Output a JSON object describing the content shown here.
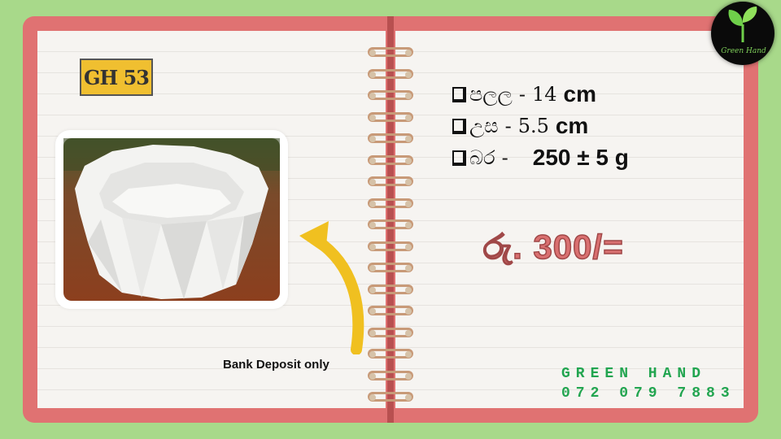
{
  "product": {
    "code": "GH 53",
    "image_icon": "white-planter-pot-photo",
    "arrow_icon": "curved-arrow-icon",
    "arrow_color": "#f0c020"
  },
  "specs": [
    {
      "label": "පලල",
      "separator": "-",
      "value": "14",
      "unit": "cm"
    },
    {
      "label": "උස",
      "separator": "-",
      "value": "5.5",
      "unit": "cm"
    },
    {
      "label": "බර",
      "separator": "-",
      "value": "250 ± 5 g",
      "unit": ""
    }
  ],
  "price": "රු. 300/=",
  "payment_note": "Bank Deposit only",
  "brand": {
    "name": "GREEN HAND",
    "phone": "072 079 7883",
    "logo_text": "Green Hand",
    "logo_icon": "sprout-icon",
    "color": "#22a550"
  },
  "colors": {
    "background": "#a8d98a",
    "notebook_cover": "#e07272",
    "page": "#f6f4f1",
    "price": "#d97070",
    "badge": "#f0bf30"
  }
}
